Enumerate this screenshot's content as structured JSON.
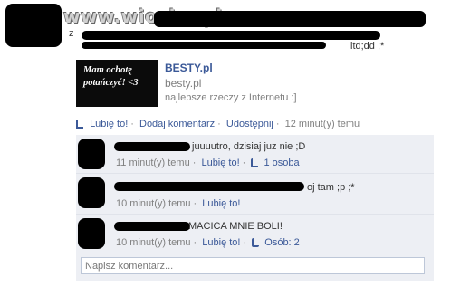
{
  "watermark": "www.wiocha.pl",
  "post": {
    "visible_text_fragment": "itd;dd ;*",
    "second_line_prefix": "z"
  },
  "link_card": {
    "thumb_text": "Mam ochotę potańczyć! <3",
    "title": "BESTY.pl",
    "domain": "besty.pl",
    "description": "najlepsze rzeczy z Internetu :]"
  },
  "actions": {
    "like": "Lubię to!",
    "comment": "Dodaj komentarz",
    "share": "Udostępnij",
    "time": "12 minut(y) temu"
  },
  "comments": [
    {
      "text": "juuuutro, dzisiaj juz nie ;D",
      "time": "11 minut(y) temu",
      "like": "Lubię to!",
      "likes": "1 osoba"
    },
    {
      "text": "oj tam ;p ;*",
      "time": "10 minut(y) temu",
      "like": "Lubię to!",
      "likes": ""
    },
    {
      "text": "MACICA MNIE BOLI!",
      "time": "10 minut(y) temu",
      "like": "Lubię to!",
      "likes": "Osób: 2"
    }
  ],
  "comment_input": {
    "placeholder": "Napisz komentarz..."
  },
  "colors": {
    "link": "#3b5998",
    "comments_bg": "#edeff4",
    "scribble": "#000000"
  }
}
